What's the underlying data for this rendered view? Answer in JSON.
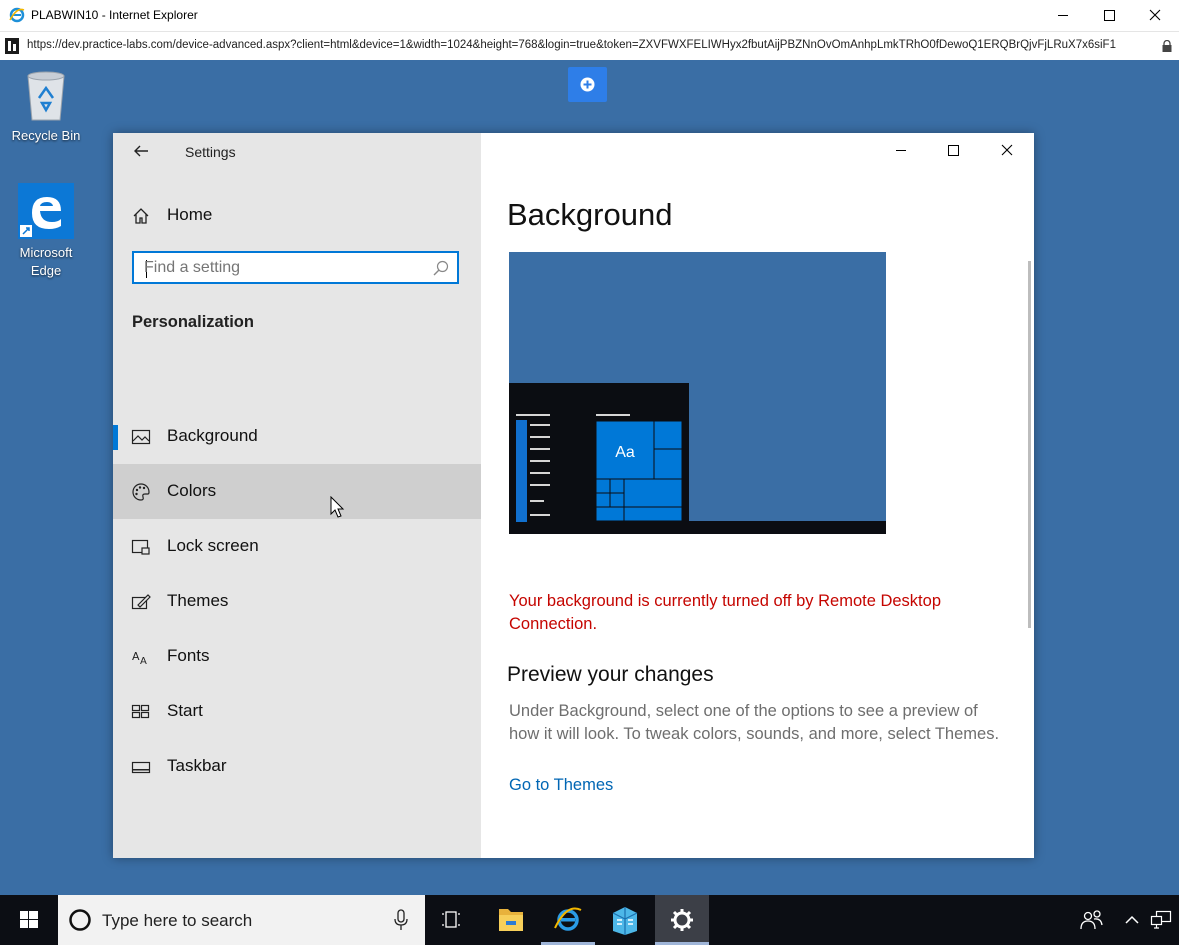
{
  "browser": {
    "title": "PLABWIN10 - Internet Explorer",
    "url": "https://dev.practice-labs.com/device-advanced.aspx?client=html&device=1&width=1024&height=768&login=true&token=ZXVFWXFELIWHyx2fbutAijPBZNnOvOmAnhpLmkTRhO0fDewoQ1ERQBrQjvFjLRuX7x6siF1"
  },
  "desktop": {
    "icons": [
      {
        "label": "Recycle Bin",
        "icon": "recycle-bin-icon"
      },
      {
        "label": "Microsoft Edge",
        "icon": "edge-icon"
      }
    ]
  },
  "settings": {
    "title": "Settings",
    "home_label": "Home",
    "search_placeholder": "Find a setting",
    "section": "Personalization",
    "nav": [
      {
        "label": "Background",
        "icon": "picture-icon",
        "active": true
      },
      {
        "label": "Colors",
        "icon": "palette-icon",
        "hover": true
      },
      {
        "label": "Lock screen",
        "icon": "lock-screen-icon"
      },
      {
        "label": "Themes",
        "icon": "themes-icon"
      },
      {
        "label": "Fonts",
        "icon": "fonts-icon"
      },
      {
        "label": "Start",
        "icon": "start-icon"
      },
      {
        "label": "Taskbar",
        "icon": "taskbar-icon"
      }
    ],
    "page_title": "Background",
    "preview_tile_text": "Aa",
    "warning": "Your background is currently turned off by Remote Desktop Connection.",
    "preview_heading": "Preview your changes",
    "preview_desc": "Under Background, select one of the options to see a preview of how it will look. To tweak colors, sounds, and more, select Themes.",
    "themes_link": "Go to Themes"
  },
  "taskbar": {
    "search_placeholder": "Type here to search",
    "apps": [
      "task-view-icon",
      "file-explorer-icon",
      "internet-explorer-icon",
      "server-manager-icon",
      "settings-gear-icon"
    ]
  },
  "colors": {
    "desktop": "#3a6ea5",
    "accent": "#0078d7",
    "warning": "#c50500",
    "link": "#0066b4"
  }
}
